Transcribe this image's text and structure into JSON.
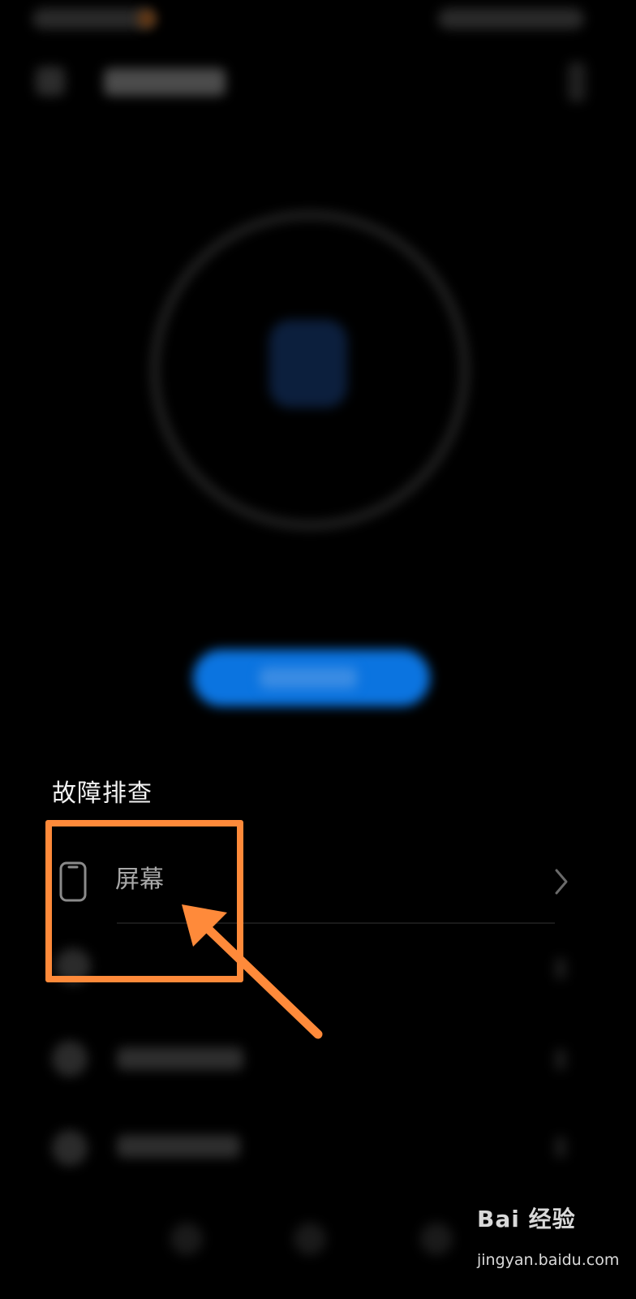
{
  "troubleshooting": {
    "section_title": "故障排查",
    "items": [
      {
        "label": "屏幕",
        "icon": "phone-outline-icon"
      }
    ]
  },
  "watermark": {
    "brand": "Bai 经验",
    "domain": "jingyan.baidu.com"
  },
  "colors": {
    "background": "#000000",
    "accent_button": "#0b74e0",
    "highlight": "#ff8a3a",
    "text_primary": "#f2f2f2",
    "text_secondary": "#a8a8a8"
  }
}
